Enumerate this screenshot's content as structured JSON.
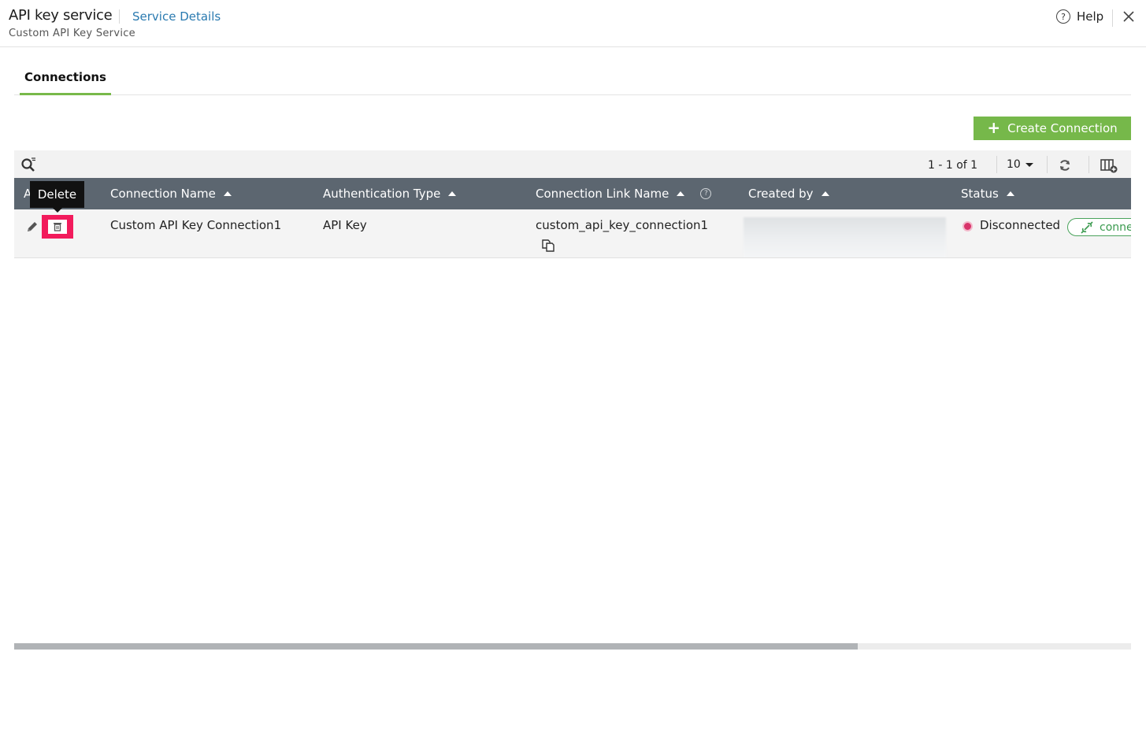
{
  "header": {
    "title": "API key service",
    "service_link": "Service Details",
    "subtitle": "Custom API Key Service",
    "help_label": "Help",
    "help_glyph": "?"
  },
  "tabs": [
    {
      "label": "Connections",
      "active": true
    }
  ],
  "actions": {
    "create_label": "Create Connection",
    "create_glyph": "+"
  },
  "toolbar": {
    "pagination": "1 - 1 of 1",
    "page_size": "10"
  },
  "table": {
    "columns": [
      "A",
      "Connection Name",
      "Authentication Type",
      "Connection Link Name",
      "Created by",
      "Status"
    ],
    "link_name_help_glyph": "?",
    "rows": [
      {
        "connection_name": "Custom API Key Connection1",
        "auth_type": "API Key",
        "link_name": "custom_api_key_connection1",
        "created_by": "",
        "status": "Disconnected",
        "connect_label": "connect"
      }
    ]
  },
  "tooltip": {
    "label": "Delete"
  },
  "colors": {
    "accent_green": "#76b84a",
    "header_bg": "#5c6670",
    "delete_red": "#f21b5c",
    "disconnected": "#d8336a",
    "link_blue": "#2a7ab0"
  },
  "icons": [
    "help-icon",
    "close-icon",
    "search-filter-icon",
    "refresh-icon",
    "columns-icon",
    "edit-icon",
    "delete-icon",
    "copy-icon",
    "connect-icon"
  ]
}
